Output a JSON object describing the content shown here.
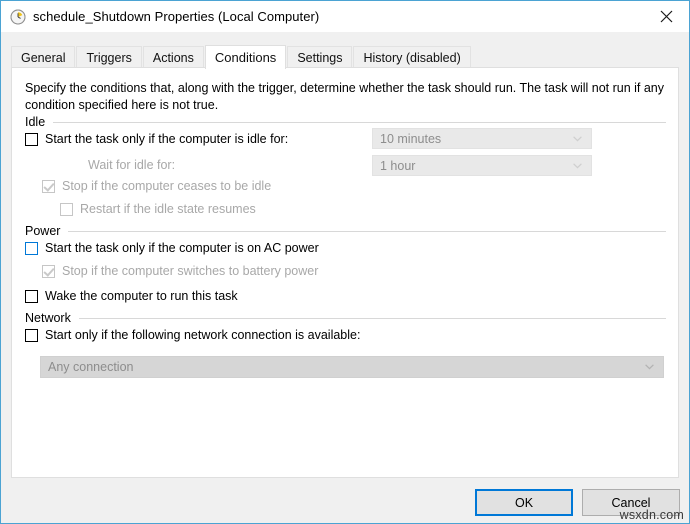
{
  "window": {
    "title": "schedule_Shutdown Properties (Local Computer)",
    "icon": "clock-task-icon",
    "close_label": "✕",
    "accent_color": "#0078d7",
    "border_color": "#4ba3d3"
  },
  "tabs": [
    {
      "label": "General",
      "selected": false
    },
    {
      "label": "Triggers",
      "selected": false
    },
    {
      "label": "Actions",
      "selected": false
    },
    {
      "label": "Conditions",
      "selected": true
    },
    {
      "label": "Settings",
      "selected": false
    },
    {
      "label": "History (disabled)",
      "selected": false
    }
  ],
  "panel": {
    "description": "Specify the conditions that, along with the trigger, determine whether the task should run.  The task will not run  if any condition specified here is not true.",
    "groups": {
      "idle": {
        "header": "Idle",
        "start_if_idle": {
          "label": "Start the task only if the computer is idle for:",
          "checked": false,
          "enabled": true
        },
        "idle_duration": {
          "value": "10 minutes",
          "enabled": false
        },
        "wait_for_idle_label": "Wait for idle for:",
        "wait_duration": {
          "value": "1 hour",
          "enabled": false
        },
        "stop_if_ceases_idle": {
          "label": "Stop if the computer ceases to be idle",
          "checked": true,
          "enabled": false
        },
        "restart_if_idle_resumes": {
          "label": "Restart if the idle state resumes",
          "checked": false,
          "enabled": false
        }
      },
      "power": {
        "header": "Power",
        "start_if_ac": {
          "label": "Start the task only if the computer is on AC power",
          "checked": false,
          "enabled": true,
          "hover": true
        },
        "stop_if_battery": {
          "label": "Stop if the computer switches to battery power",
          "checked": true,
          "enabled": false
        },
        "wake_computer": {
          "label": "Wake the computer to run this task",
          "checked": false,
          "enabled": true
        }
      },
      "network": {
        "header": "Network",
        "start_if_network": {
          "label": "Start only if the following network connection is available:",
          "checked": false,
          "enabled": true
        },
        "connection": {
          "value": "Any connection",
          "enabled": false
        }
      }
    }
  },
  "footer": {
    "ok_label": "OK",
    "cancel_label": "Cancel"
  },
  "watermark": "wsxdn.com"
}
